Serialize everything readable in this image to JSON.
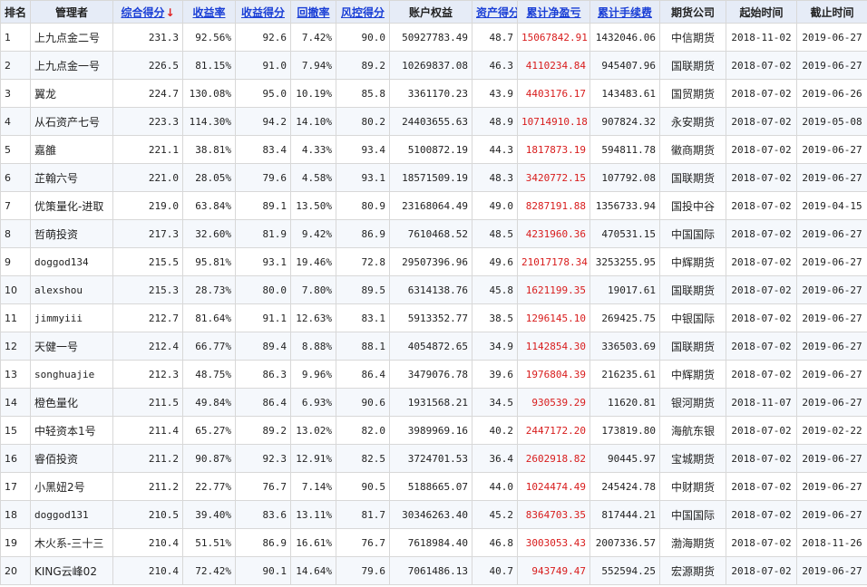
{
  "header": {
    "rank": "排名",
    "manager": "管理者",
    "composite": "综合得分",
    "sort_arrow": "↓",
    "return_rate": "收益率",
    "return_score": "收益得分",
    "drawdown": "回撤率",
    "risk_score": "风控得分",
    "equity": "账户权益",
    "asset_score": "资产得分",
    "net_profit": "累计净盈亏",
    "fees": "累计手续费",
    "company": "期货公司",
    "start": "起始时间",
    "end": "截止时间"
  },
  "colors": {
    "header_bg": "#e6ecf7",
    "link": "#1a3fd6",
    "profit_red": "#d81c1c",
    "stripe": "#f5f8fc"
  },
  "rows": [
    {
      "rank": "1",
      "manager": "上九点金二号",
      "composite": "231.3",
      "return_rate": "92.56%",
      "return_score": "92.6",
      "drawdown": "7.42%",
      "risk_score": "90.0",
      "equity": "50927783.49",
      "asset_score": "48.7",
      "net_profit": "15067842.91",
      "fees": "1432046.06",
      "company": "中信期货",
      "start": "2018-11-02",
      "end": "2019-06-27"
    },
    {
      "rank": "2",
      "manager": "上九点金一号",
      "composite": "226.5",
      "return_rate": "81.15%",
      "return_score": "91.0",
      "drawdown": "7.94%",
      "risk_score": "89.2",
      "equity": "10269837.08",
      "asset_score": "46.3",
      "net_profit": "4110234.84",
      "fees": "945407.96",
      "company": "国联期货",
      "start": "2018-07-02",
      "end": "2019-06-27"
    },
    {
      "rank": "3",
      "manager": "翼龙",
      "composite": "224.7",
      "return_rate": "130.08%",
      "return_score": "95.0",
      "drawdown": "10.19%",
      "risk_score": "85.8",
      "equity": "3361170.23",
      "asset_score": "43.9",
      "net_profit": "4403176.17",
      "fees": "143483.61",
      "company": "国贸期货",
      "start": "2018-07-02",
      "end": "2019-06-26"
    },
    {
      "rank": "4",
      "manager": "从石资产七号",
      "composite": "223.3",
      "return_rate": "114.30%",
      "return_score": "94.2",
      "drawdown": "14.10%",
      "risk_score": "80.2",
      "equity": "24403655.63",
      "asset_score": "48.9",
      "net_profit": "10714910.18",
      "fees": "907824.32",
      "company": "永安期货",
      "start": "2018-07-02",
      "end": "2019-05-08"
    },
    {
      "rank": "5",
      "manager": "嘉雒",
      "composite": "221.1",
      "return_rate": "38.81%",
      "return_score": "83.4",
      "drawdown": "4.33%",
      "risk_score": "93.4",
      "equity": "5100872.19",
      "asset_score": "44.3",
      "net_profit": "1817873.19",
      "fees": "594811.78",
      "company": "徽商期货",
      "start": "2018-07-02",
      "end": "2019-06-27"
    },
    {
      "rank": "6",
      "manager": "芷翰六号",
      "composite": "221.0",
      "return_rate": "28.05%",
      "return_score": "79.6",
      "drawdown": "4.58%",
      "risk_score": "93.1",
      "equity": "18571509.19",
      "asset_score": "48.3",
      "net_profit": "3420772.15",
      "fees": "107792.08",
      "company": "国联期货",
      "start": "2018-07-02",
      "end": "2019-06-27"
    },
    {
      "rank": "7",
      "manager": "优策量化-进取",
      "composite": "219.0",
      "return_rate": "63.84%",
      "return_score": "89.1",
      "drawdown": "13.50%",
      "risk_score": "80.9",
      "equity": "23168064.49",
      "asset_score": "49.0",
      "net_profit": "8287191.88",
      "fees": "1356733.94",
      "company": "国投中谷",
      "start": "2018-07-02",
      "end": "2019-04-15"
    },
    {
      "rank": "8",
      "manager": "哲萌投资",
      "composite": "217.3",
      "return_rate": "32.60%",
      "return_score": "81.9",
      "drawdown": "9.42%",
      "risk_score": "86.9",
      "equity": "7610468.52",
      "asset_score": "48.5",
      "net_profit": "4231960.36",
      "fees": "470531.15",
      "company": "中国国际",
      "start": "2018-07-02",
      "end": "2019-06-27"
    },
    {
      "rank": "9",
      "manager": "doggod134",
      "composite": "215.5",
      "return_rate": "95.81%",
      "return_score": "93.1",
      "drawdown": "19.46%",
      "risk_score": "72.8",
      "equity": "29507396.96",
      "asset_score": "49.6",
      "net_profit": "21017178.34",
      "fees": "3253255.95",
      "company": "中辉期货",
      "start": "2018-07-02",
      "end": "2019-06-27"
    },
    {
      "rank": "10",
      "manager": "alexshou",
      "composite": "215.3",
      "return_rate": "28.73%",
      "return_score": "80.0",
      "drawdown": "7.80%",
      "risk_score": "89.5",
      "equity": "6314138.76",
      "asset_score": "45.8",
      "net_profit": "1621199.35",
      "fees": "19017.61",
      "company": "国联期货",
      "start": "2018-07-02",
      "end": "2019-06-27"
    },
    {
      "rank": "11",
      "manager": "jimmyiii",
      "composite": "212.7",
      "return_rate": "81.64%",
      "return_score": "91.1",
      "drawdown": "12.63%",
      "risk_score": "83.1",
      "equity": "5913352.77",
      "asset_score": "38.5",
      "net_profit": "1296145.10",
      "fees": "269425.75",
      "company": "中银国际",
      "start": "2018-07-02",
      "end": "2019-06-27"
    },
    {
      "rank": "12",
      "manager": "天健一号",
      "composite": "212.4",
      "return_rate": "66.77%",
      "return_score": "89.4",
      "drawdown": "8.88%",
      "risk_score": "88.1",
      "equity": "4054872.65",
      "asset_score": "34.9",
      "net_profit": "1142854.30",
      "fees": "336503.69",
      "company": "国联期货",
      "start": "2018-07-02",
      "end": "2019-06-27"
    },
    {
      "rank": "13",
      "manager": "songhuajie",
      "composite": "212.3",
      "return_rate": "48.75%",
      "return_score": "86.3",
      "drawdown": "9.96%",
      "risk_score": "86.4",
      "equity": "3479076.78",
      "asset_score": "39.6",
      "net_profit": "1976804.39",
      "fees": "216235.61",
      "company": "中辉期货",
      "start": "2018-07-02",
      "end": "2019-06-27"
    },
    {
      "rank": "14",
      "manager": "橙色量化",
      "composite": "211.5",
      "return_rate": "49.84%",
      "return_score": "86.4",
      "drawdown": "6.93%",
      "risk_score": "90.6",
      "equity": "1931568.21",
      "asset_score": "34.5",
      "net_profit": "930539.29",
      "fees": "11620.81",
      "company": "银河期货",
      "start": "2018-11-07",
      "end": "2019-06-27"
    },
    {
      "rank": "15",
      "manager": "中轻资本1号",
      "composite": "211.4",
      "return_rate": "65.27%",
      "return_score": "89.2",
      "drawdown": "13.02%",
      "risk_score": "82.0",
      "equity": "3989969.16",
      "asset_score": "40.2",
      "net_profit": "2447172.20",
      "fees": "173819.80",
      "company": "海航东银",
      "start": "2018-07-02",
      "end": "2019-02-22"
    },
    {
      "rank": "16",
      "manager": "睿佰投资",
      "composite": "211.2",
      "return_rate": "90.87%",
      "return_score": "92.3",
      "drawdown": "12.91%",
      "risk_score": "82.5",
      "equity": "3724701.53",
      "asset_score": "36.4",
      "net_profit": "2602918.82",
      "fees": "90445.97",
      "company": "宝城期货",
      "start": "2018-07-02",
      "end": "2019-06-27"
    },
    {
      "rank": "17",
      "manager": "小黑妞2号",
      "composite": "211.2",
      "return_rate": "22.77%",
      "return_score": "76.7",
      "drawdown": "7.14%",
      "risk_score": "90.5",
      "equity": "5188665.07",
      "asset_score": "44.0",
      "net_profit": "1024474.49",
      "fees": "245424.78",
      "company": "中财期货",
      "start": "2018-07-02",
      "end": "2019-06-27"
    },
    {
      "rank": "18",
      "manager": "doggod131",
      "composite": "210.5",
      "return_rate": "39.40%",
      "return_score": "83.6",
      "drawdown": "13.11%",
      "risk_score": "81.7",
      "equity": "30346263.40",
      "asset_score": "45.2",
      "net_profit": "8364703.35",
      "fees": "817444.21",
      "company": "中国国际",
      "start": "2018-07-02",
      "end": "2019-06-27"
    },
    {
      "rank": "19",
      "manager": "木火系-三十三",
      "composite": "210.4",
      "return_rate": "51.51%",
      "return_score": "86.9",
      "drawdown": "16.61%",
      "risk_score": "76.7",
      "equity": "7618984.40",
      "asset_score": "46.8",
      "net_profit": "3003053.43",
      "fees": "2007336.57",
      "company": "渤海期货",
      "start": "2018-07-02",
      "end": "2018-11-26"
    },
    {
      "rank": "20",
      "manager": "KING云峰02",
      "composite": "210.4",
      "return_rate": "72.42%",
      "return_score": "90.1",
      "drawdown": "14.64%",
      "risk_score": "79.6",
      "equity": "7061486.13",
      "asset_score": "40.7",
      "net_profit": "943749.47",
      "fees": "552594.25",
      "company": "宏源期货",
      "start": "2018-07-02",
      "end": "2019-06-27"
    }
  ]
}
